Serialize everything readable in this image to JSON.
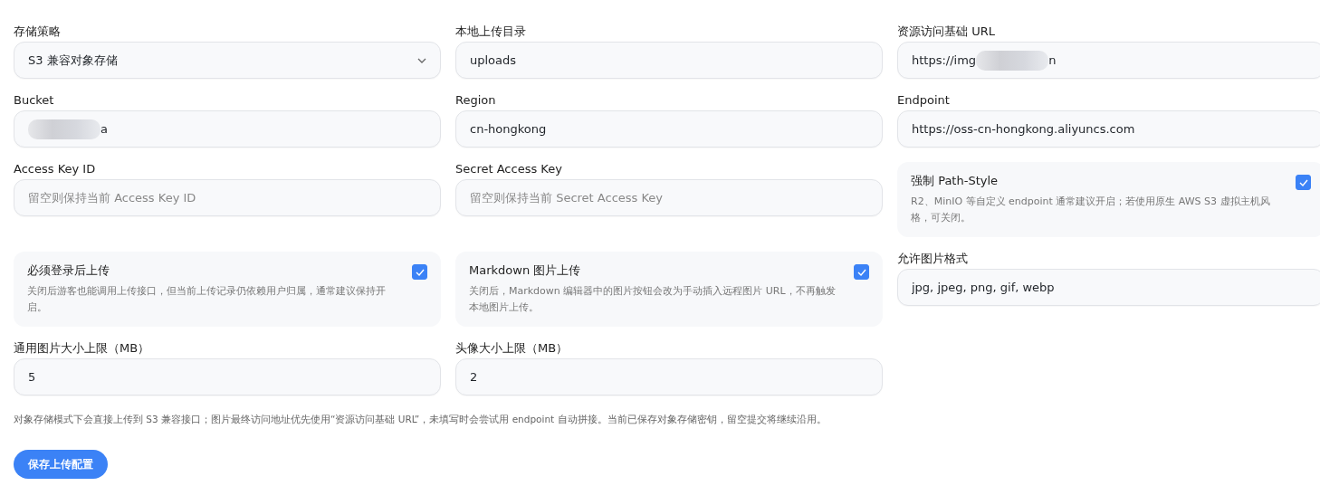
{
  "fields": [
    {
      "kind": "select",
      "label": "存储策略",
      "value": "S3 兼容对象存储"
    },
    {
      "kind": "input",
      "label": "本地上传目录",
      "value": "uploads"
    },
    {
      "kind": "redacted",
      "label": "资源访问基础 URL",
      "value_before": "https://img",
      "value_after": "n"
    },
    {
      "kind": "redacted",
      "label": "Bucket",
      "value_after": "a"
    },
    {
      "kind": "input",
      "label": "Region",
      "value": "cn-hongkong"
    },
    {
      "kind": "input",
      "label": "Endpoint",
      "value": "https://oss-cn-hongkong.aliyuncs.com"
    },
    {
      "kind": "input",
      "label": "Access Key ID",
      "placeholder": "留空则保持当前 Access Key ID"
    },
    {
      "kind": "input",
      "label": "Secret Access Key",
      "placeholder": "留空则保持当前 Secret Access Key"
    },
    {
      "kind": "toggle_card",
      "title": "强制 Path-Style",
      "description": "R2、MinIO 等自定义 endpoint 通常建议开启；若使用原生 AWS S3 虚拟主机风格，可关闭。",
      "checked": true
    },
    {
      "kind": "toggle_card",
      "title": "必须登录后上传",
      "description": "关闭后游客也能调用上传接口，但当前上传记录仍依赖用户归属，通常建议保持开启。",
      "checked": true
    },
    {
      "kind": "toggle_card",
      "title": "Markdown 图片上传",
      "description": "关闭后，Markdown 编辑器中的图片按钮会改为手动插入远程图片 URL，不再触发本地图片上传。",
      "checked": true
    },
    {
      "kind": "input",
      "label": "允许图片格式",
      "value": "jpg, jpeg, png, gif, webp"
    },
    {
      "kind": "input",
      "label": "通用图片大小上限（MB）",
      "value": "5"
    },
    {
      "kind": "input",
      "label": "头像大小上限（MB）",
      "value": "2"
    }
  ],
  "note": "对象存储模式下会直接上传到 S3 兼容接口；图片最终访问地址优先使用“资源访问基础 URL”，未填写时会尝试用 endpoint 自动拼接。当前已保存对象存储密钥，留空提交将继续沿用。",
  "save_button": "保存上传配置"
}
